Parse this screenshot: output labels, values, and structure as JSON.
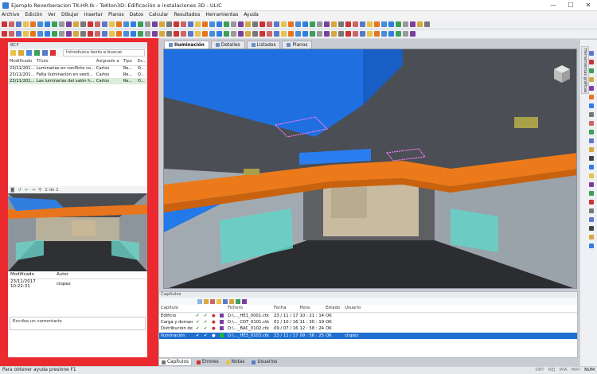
{
  "window": {
    "title": "Ejemplo Reverberacion TK-HR.tk - TeKton3D: Edificación e instalaciones 3D - ULIC",
    "minimize": "—",
    "maximize": "☐",
    "close": "✕"
  },
  "menu": [
    "Archivo",
    "Edición",
    "Ver",
    "Dibujar",
    "Insertar",
    "Planos",
    "Datos",
    "Calcular",
    "Resultados",
    "Herramientas",
    "Ayuda"
  ],
  "bcf": {
    "panel_title": "BCF",
    "search_placeholder": "Introduzca texto a buscar",
    "columns": [
      "Modificado",
      "Título",
      "Asignado a",
      "Tipo",
      "Es..."
    ],
    "issues": [
      {
        "modified": "23/11/201...",
        "title": "Luminarias en conflicto co...",
        "assigned": "Carlos",
        "type": "Re...",
        "status": "O..."
      },
      {
        "modified": "23/11/201...",
        "title": "Falta iluminación en vesti...",
        "assigned": "Carlos",
        "type": "Re...",
        "status": "O..."
      },
      {
        "modified": "23/11/201...",
        "title": "Las luminarias del salón h...",
        "assigned": "Carlos",
        "type": "Re...",
        "status": "O..."
      }
    ],
    "pager": "2 de 2",
    "comment_columns": [
      "Modificado",
      "Autor"
    ],
    "comments": [
      {
        "modified": "23/11/2017 10:22:31",
        "author": "clopez"
      }
    ],
    "comment_placeholder": "Escriba un comentario"
  },
  "view_tabs": [
    {
      "label": "Iluminación",
      "active": true
    },
    {
      "label": "Detalles",
      "active": false
    },
    {
      "label": "Listados",
      "active": false
    },
    {
      "label": "Planos",
      "active": false
    }
  ],
  "palette": {
    "tab_label": "Herramientas gráficas"
  },
  "chapters": {
    "panel_title": "Capítulos",
    "columns": [
      "Capítulo",
      "",
      "",
      "",
      "",
      "Fichero",
      "Fecha",
      "Hora",
      "Estado",
      "Usuario"
    ],
    "rows": [
      {
        "name": "Edificio",
        "color": "#7b3fa0",
        "file": "D:\\..._HE1_0001.ctk",
        "date": "23 / 11 / 17",
        "time": "10 : 21 : 14",
        "state": "OK",
        "user": "",
        "selected": false
      },
      {
        "name": "Carga y deman",
        "color": "#7b3fa0",
        "file": "D:\\..._CDT_0101.ctk",
        "date": "01 / 10 / 16",
        "time": "11 : 30 : 19",
        "state": "OK",
        "user": "",
        "selected": false
      },
      {
        "name": "Distribución de",
        "color": "#7b3fa0",
        "file": "D:\\..._BAC_0102.ctk",
        "date": "09 / 07 / 16",
        "time": "12 : 58 : 24",
        "state": "OK",
        "user": "",
        "selected": false
      },
      {
        "name": "Iluminación",
        "color": "#22bb22",
        "file": "D:\\..._HE3_0103.ctk",
        "date": "23 / 11 / 17",
        "time": "09 : 56 : 25",
        "state": "OK",
        "user": "clopez",
        "selected": true
      }
    ]
  },
  "bottom_tabs": [
    {
      "label": "Capítulos",
      "active": true
    },
    {
      "label": "Errores",
      "active": false
    },
    {
      "label": "Notas",
      "active": false
    },
    {
      "label": "Usuarios",
      "active": false
    }
  ],
  "status": {
    "message": "Para obtener ayuda presione F1",
    "indicators": [
      "ORT",
      "REJ",
      "IMA",
      "MAY",
      "NUM"
    ]
  }
}
